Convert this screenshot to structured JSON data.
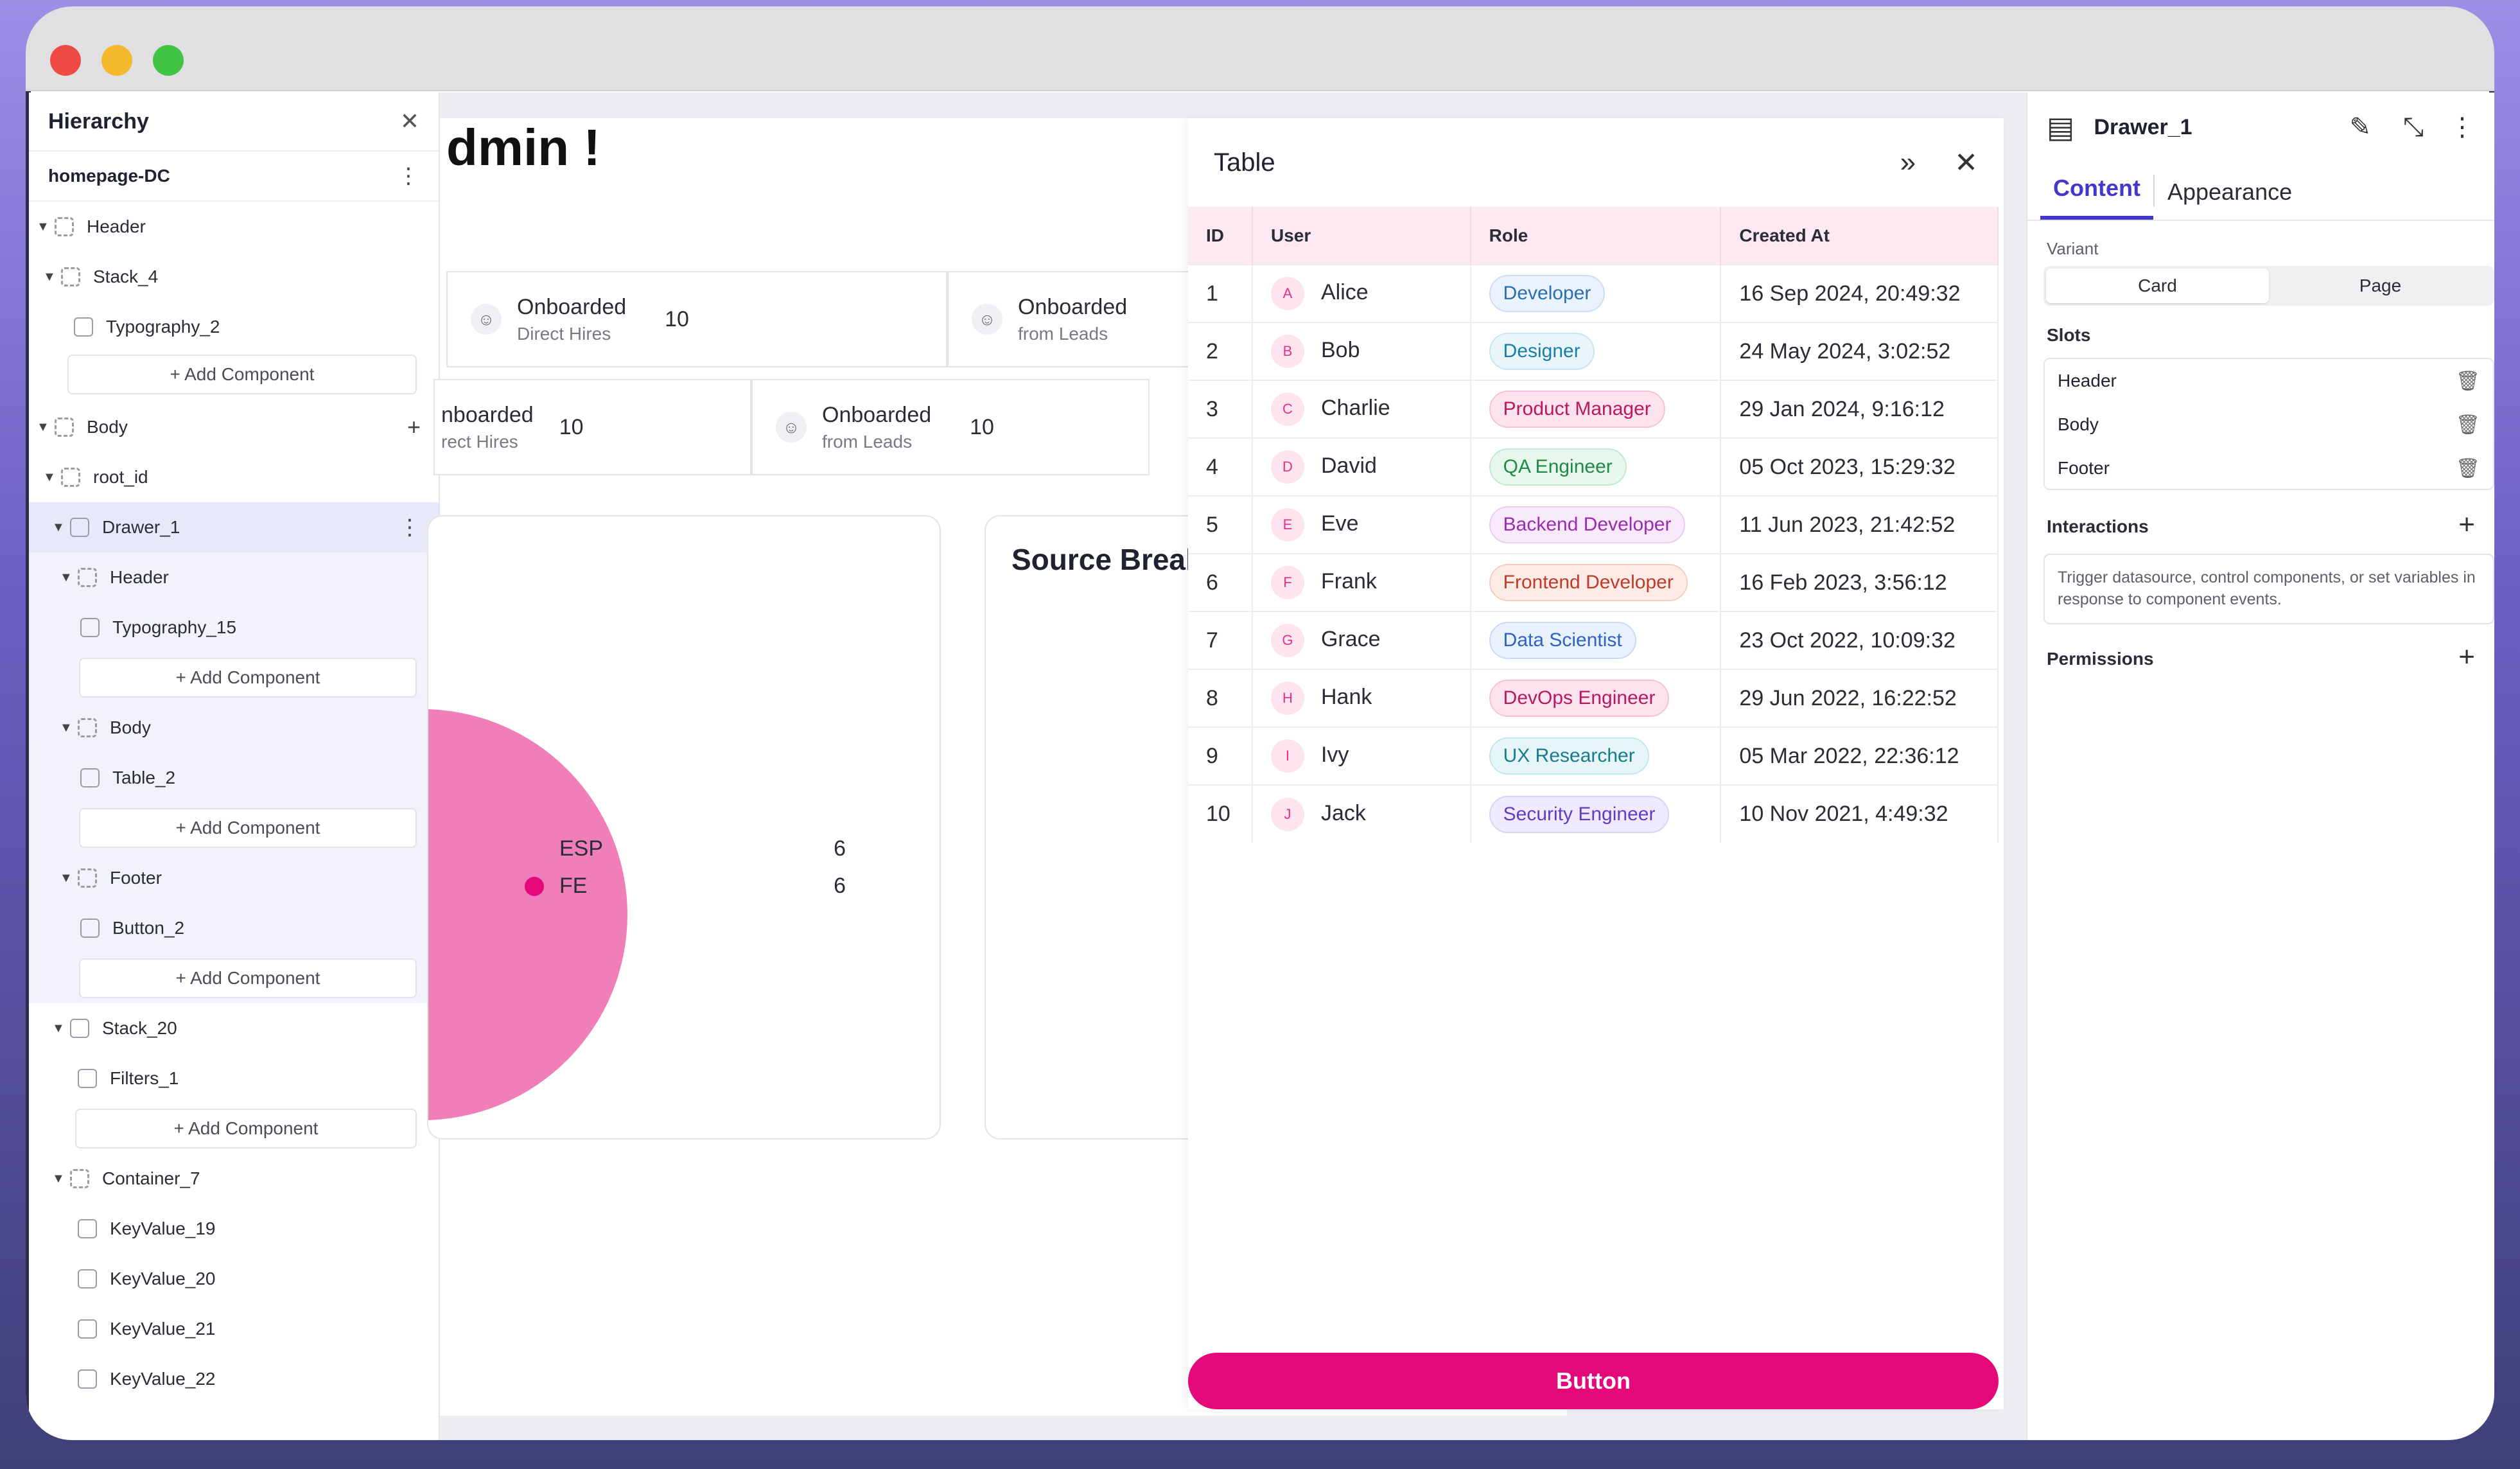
{
  "hierarchy": {
    "title": "Hierarchy",
    "root": "homepage-DC",
    "nodes": [
      {
        "label": "Header"
      },
      {
        "label": "Stack_4"
      },
      {
        "label": "Typography_2"
      },
      {
        "label": "Body"
      },
      {
        "label": "root_id"
      },
      {
        "label": "Drawer_1"
      },
      {
        "label": "Header"
      },
      {
        "label": "Typography_15"
      },
      {
        "label": "Body"
      },
      {
        "label": "Table_2"
      },
      {
        "label": "Footer"
      },
      {
        "label": "Button_2"
      },
      {
        "label": "Stack_20"
      },
      {
        "label": "Filters_1"
      },
      {
        "label": "Container_7"
      },
      {
        "label": "KeyValue_19"
      },
      {
        "label": "KeyValue_20"
      },
      {
        "label": "KeyValue_21"
      },
      {
        "label": "KeyValue_22"
      }
    ],
    "add_label": "+ Add Component"
  },
  "canvas": {
    "greeting": "dmin !",
    "stats_row1": [
      {
        "title": "Onboarded",
        "sub": "Direct Hires",
        "value": "10"
      },
      {
        "title": "Onboarded",
        "sub": "from Leads",
        "value": ""
      }
    ],
    "stats_row2": [
      {
        "title": "nboarded",
        "sub": "rect Hires",
        "value": "10"
      },
      {
        "title": "Onboarded",
        "sub": "from Leads",
        "value": "10"
      }
    ],
    "legend": [
      {
        "name": "ESP",
        "value": "6",
        "color": "#f07fb9"
      },
      {
        "name": "FE",
        "value": "6",
        "color": "#e5087a"
      }
    ],
    "card2_title": "Source Break"
  },
  "drawer": {
    "title": "Table",
    "button": "Button",
    "columns": [
      "ID",
      "User",
      "Role",
      "Created At"
    ],
    "rows": [
      {
        "id": "1",
        "initial": "A",
        "user": "Alice",
        "role": "Developer",
        "created": "16 Sep 2024, 20:49:32"
      },
      {
        "id": "2",
        "initial": "B",
        "user": "Bob",
        "role": "Designer",
        "created": "24 May 2024, 3:02:52"
      },
      {
        "id": "3",
        "initial": "C",
        "user": "Charlie",
        "role": "Product Manager",
        "created": "29 Jan 2024, 9:16:12"
      },
      {
        "id": "4",
        "initial": "D",
        "user": "David",
        "role": "QA Engineer",
        "created": "05 Oct 2023, 15:29:32"
      },
      {
        "id": "5",
        "initial": "E",
        "user": "Eve",
        "role": "Backend Developer",
        "created": "11 Jun 2023, 21:42:52"
      },
      {
        "id": "6",
        "initial": "F",
        "user": "Frank",
        "role": "Frontend Developer",
        "created": "16 Feb 2023, 3:56:12"
      },
      {
        "id": "7",
        "initial": "G",
        "user": "Grace",
        "role": "Data Scientist",
        "created": "23 Oct 2022, 10:09:32"
      },
      {
        "id": "8",
        "initial": "H",
        "user": "Hank",
        "role": "DevOps Engineer",
        "created": "29 Jun 2022, 16:22:52"
      },
      {
        "id": "9",
        "initial": "I",
        "user": "Ivy",
        "role": "UX Researcher",
        "created": "05 Mar 2022, 22:36:12"
      },
      {
        "id": "10",
        "initial": "J",
        "user": "Jack",
        "role": "Security Engineer",
        "created": "10 Nov 2021, 4:49:32"
      }
    ]
  },
  "props": {
    "title": "Drawer_1",
    "tabs": [
      "Content",
      "Appearance"
    ],
    "variant_label": "Variant",
    "variants": [
      "Card",
      "Page"
    ],
    "slots_label": "Slots",
    "slots": [
      "Header",
      "Body",
      "Footer"
    ],
    "interactions_label": "Interactions",
    "interactions_hint": "Trigger datasource, control components, or set variables in response to component events.",
    "permissions_label": "Permissions"
  },
  "colors": {
    "accent": "#e5087a",
    "tab_active": "#4338ca",
    "selected_row": "#e8e8fb"
  },
  "icons": [
    "close-icon",
    "kebab-icon",
    "plus-icon",
    "expand-icon",
    "edit-icon",
    "collapse-icon",
    "trash-icon",
    "user-icon",
    "drawer-icon"
  ]
}
